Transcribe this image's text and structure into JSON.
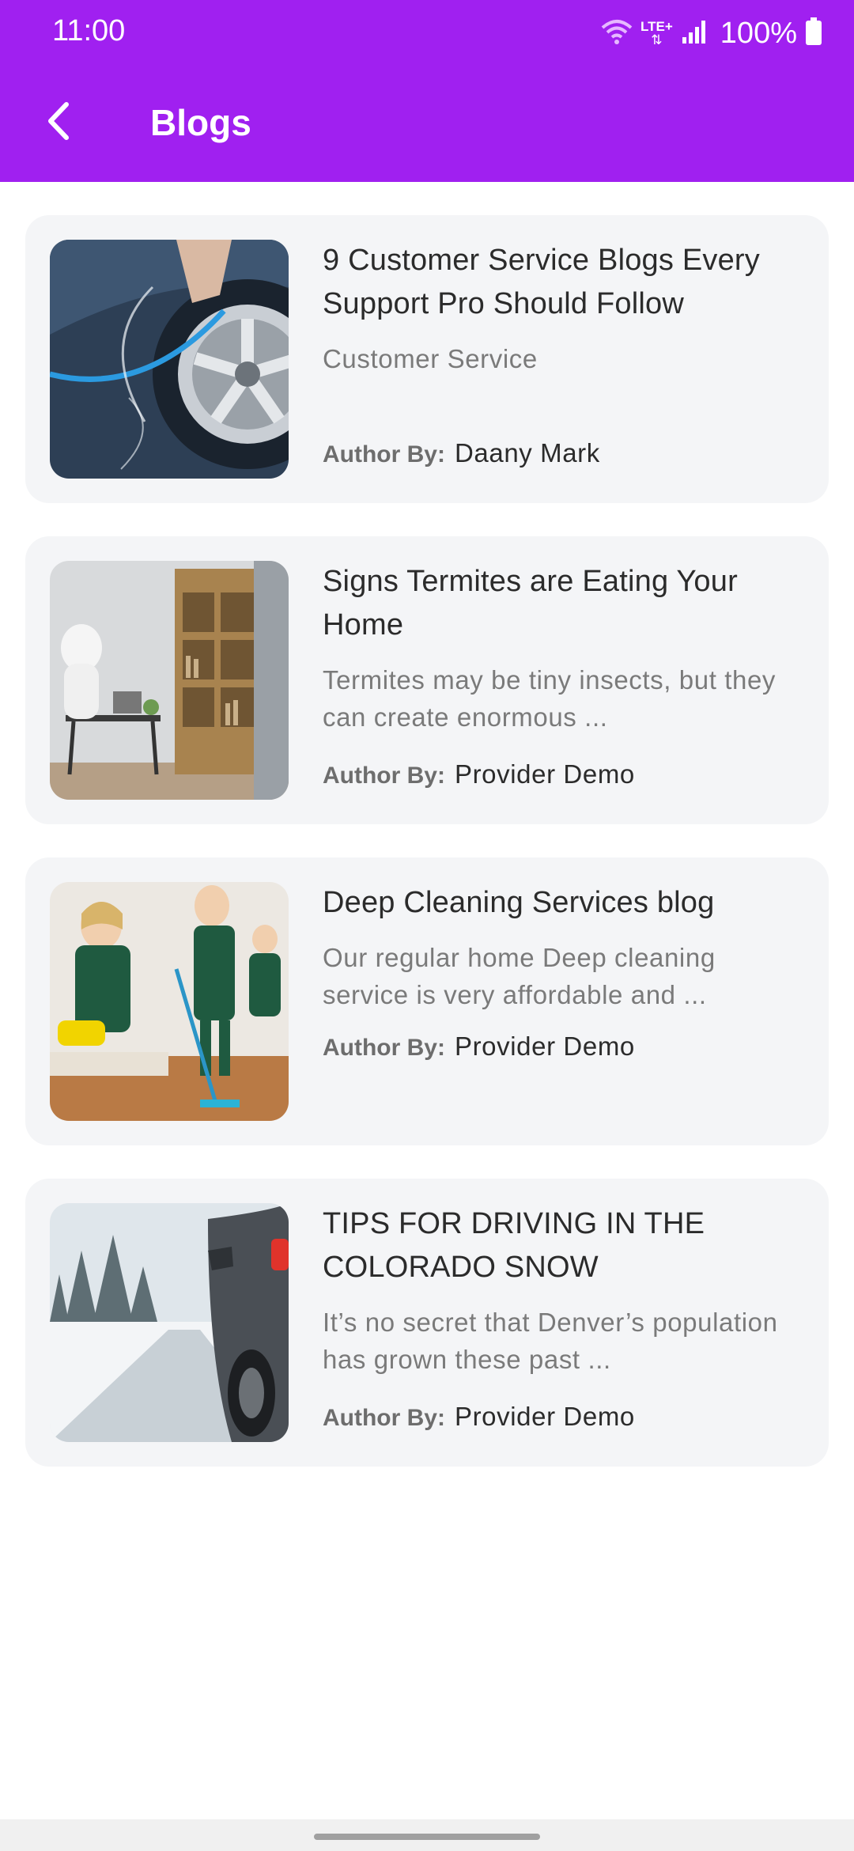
{
  "status_bar": {
    "time": "11:00",
    "network": "LTE+",
    "battery": "100%"
  },
  "header": {
    "title": "Blogs",
    "back_icon": "chevron-left-icon"
  },
  "colors": {
    "primary": "#a020f0",
    "card_bg": "#f4f5f7"
  },
  "blogs": [
    {
      "title": "9 Customer Service Blogs Every Support Pro Should Follow",
      "description": "Customer Service",
      "author_label": "Author By:",
      "author": "Daany Mark",
      "image": "car-wash-photo"
    },
    {
      "title": "Signs Termites are Eating Your Home",
      "description": "Termites may be tiny insects, but they can create enormous ...",
      "author_label": "Author By:",
      "author": "Provider Demo",
      "image": "termite-inspection-photo"
    },
    {
      "title": "Deep Cleaning Services blog",
      "description": "Our regular home Deep cleaning service is very affordable and ...",
      "author_label": "Author By:",
      "author": "Provider Demo",
      "image": "cleaning-crew-photo"
    },
    {
      "title": "TIPS FOR DRIVING IN THE COLORADO SNOW",
      "description": "It’s no secret that Denver’s population has grown these past ...",
      "author_label": "Author By:",
      "author": "Provider Demo",
      "image": "snowy-road-photo"
    }
  ]
}
